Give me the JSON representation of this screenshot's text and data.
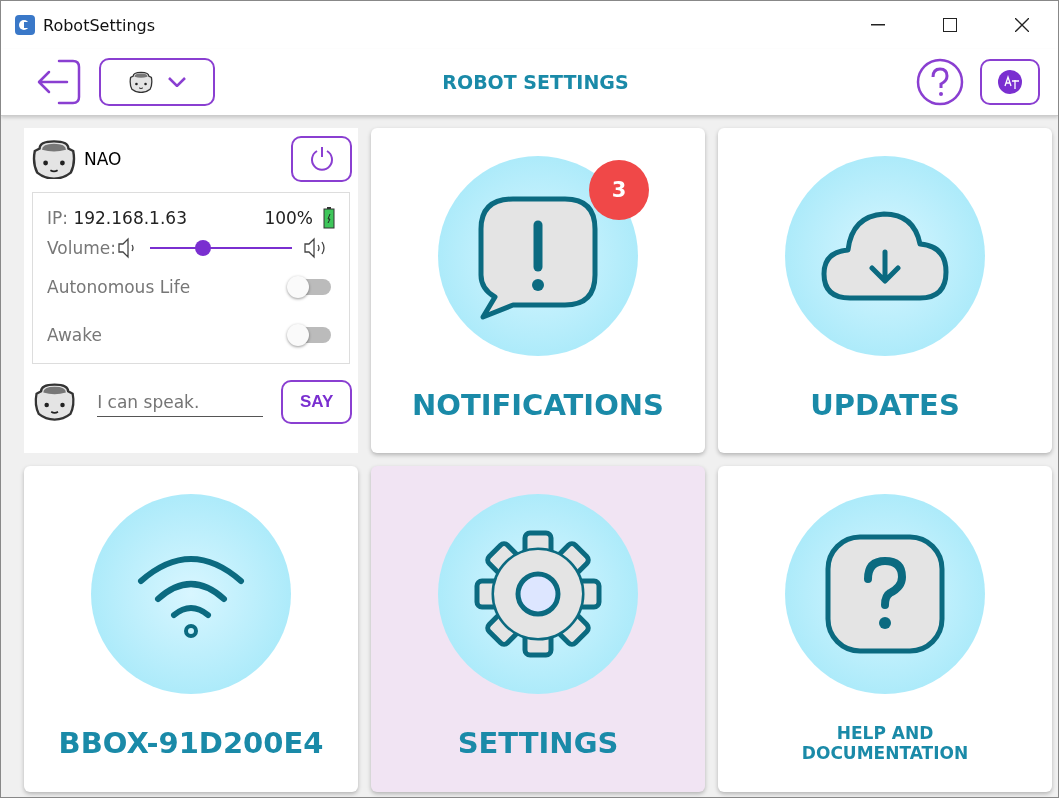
{
  "window": {
    "title": "RobotSettings"
  },
  "toolbar": {
    "title": "ROBOT SETTINGS"
  },
  "robot": {
    "name": "NAO",
    "ip_label": "IP:",
    "ip": "192.168.1.63",
    "battery": "100%",
    "volume_label": "Volume:",
    "volume": {
      "level": 0.36
    },
    "toggles": [
      {
        "label": "Autonomous Life",
        "on": false
      },
      {
        "label": "Awake",
        "on": false
      }
    ],
    "speech": {
      "placeholder": "I can speak.",
      "button": "SAY"
    }
  },
  "tiles": [
    {
      "kind": "notifications",
      "label": "NOTIFICATIONS",
      "badge": "3",
      "selected": false
    },
    {
      "kind": "updates",
      "label": "UPDATES",
      "selected": false
    },
    {
      "kind": "wifi",
      "label": "BBOX-91D200E4",
      "selected": false
    },
    {
      "kind": "settings",
      "label": "SETTINGS",
      "selected": true
    },
    {
      "kind": "help",
      "label": "HELP AND DOCUMENTATION",
      "selected": false
    }
  ]
}
